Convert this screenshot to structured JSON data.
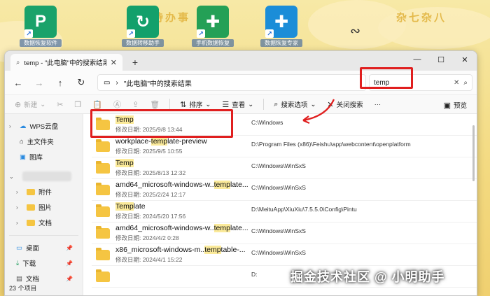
{
  "desktop": {
    "icons": [
      {
        "label": "数据恢复软件",
        "color": "#1aa26a",
        "glyph": "P"
      },
      {
        "label": "数据转移助手",
        "color": "#13a06b",
        "glyph": "↻"
      },
      {
        "label": "手机数据恢复",
        "color": "#24a056",
        "glyph": "✚"
      },
      {
        "label": "数据恢复专家",
        "color": "#1b8dd8",
        "glyph": "✚"
      }
    ],
    "deco_left": "待办事",
    "deco_right": "杂七杂八"
  },
  "window": {
    "tab_title": "temp - \"此电脑\"中的搜索结果",
    "breadcrumb": "\"此电脑\"中的搜索结果",
    "search_value": "temp",
    "toolbar": {
      "new": "新建",
      "sort": "排序",
      "view": "查看",
      "search_options": "搜索选项",
      "close_search": "关闭搜索",
      "more": "···",
      "preview": "预览"
    },
    "nav": {
      "wps": "WPS云盘",
      "home": "主文件夹",
      "gallery": "图库",
      "attachments": "附件",
      "pictures": "图片",
      "documents": "文档",
      "desktop": "桌面",
      "downloads": "下载",
      "documents2": "文档"
    },
    "status": "23 个项目"
  },
  "results": [
    {
      "pre": "",
      "hl": "Temp",
      "post": "",
      "date": "修改日期: 2025/9/8 13:44",
      "path": "C:\\Windows"
    },
    {
      "pre": "workplace-",
      "hl": "temp",
      "post": "late-preview",
      "date": "修改日期: 2025/9/5 10:55",
      "path": "D:\\Program Files (x86)\\Feishu\\app\\webcontent\\openplatform"
    },
    {
      "pre": "",
      "hl": "Temp",
      "post": "",
      "date": "修改日期: 2025/8/13 12:32",
      "path": "C:\\Windows\\WinSxS"
    },
    {
      "pre": "amd64_microsoft-windows-w..",
      "hl": "temp",
      "post": "late...",
      "date": "修改日期: 2025/2/24 12:17",
      "path": "C:\\Windows\\WinSxS"
    },
    {
      "pre": "",
      "hl": "Temp",
      "post": "late",
      "date": "修改日期: 2024/5/20 17:56",
      "path": "D:\\MeituApp\\XiuXiu\\7.5.5.0\\Config\\Pintu"
    },
    {
      "pre": "amd64_microsoft-windows-w..",
      "hl": "temp",
      "post": "late...",
      "date": "修改日期: 2024/4/2 0:28",
      "path": "C:\\Windows\\WinSxS"
    },
    {
      "pre": "x86_microsoft-windows-m..",
      "hl": "temp",
      "post": "table-...",
      "date": "修改日期: 2024/4/1 15:22",
      "path": "C:\\Windows\\WinSxS"
    },
    {
      "pre": "",
      "hl": "",
      "post": "",
      "date": "",
      "path": "D:"
    }
  ],
  "watermark": "掘金技术社区 @ 小明助手",
  "accent": "#e01f1f"
}
